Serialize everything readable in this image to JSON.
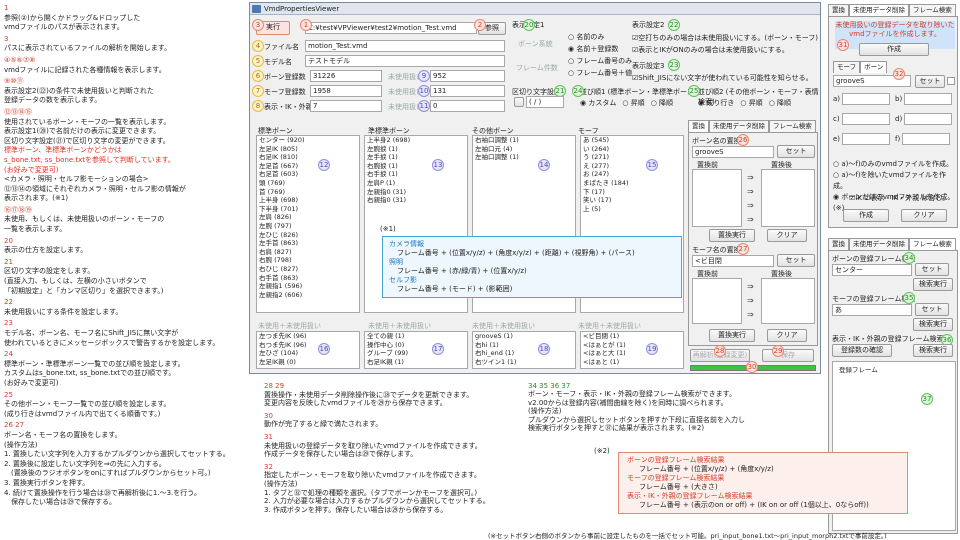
{
  "left_notes": [
    {
      "n": "1",
      "lines": [
        "参照(②)から開くかドラッグ&ドロップした",
        "vmdファイルのパスが表示されます。"
      ]
    },
    {
      "n": "3",
      "lines": [
        "パスに表示されているファイルの解析を開始します。"
      ]
    },
    {
      "n": "④⑤⑥⑦⑧",
      "lines": [
        "vmdファイルに記録された各種情報を表示します。"
      ]
    },
    {
      "n": "⑨⑩⑪",
      "lines": [
        "表示設定2(㉒)の条件で未使用扱いと判断された",
        "登録データの数を表示します。"
      ]
    },
    {
      "n": "⑫⑬⑭⑮",
      "lines": [
        "使用されているボーン・モーフの一覧を表示します。",
        "表示設定1(⑳)で名前だけの表示に変更できます。",
        "区切り文字設定(㉑)で区切り文字の変更ができます。"
      ],
      "red": [
        "標準ボーン、準標準ボーンかどうかは",
        "s_bone.txt, ss_bone.txtを参照して判断しています。",
        "(お好みで変更可)"
      ],
      "extra": [
        "<カメラ・照明・セルフ影モーションの場合>",
        "⑫⑬⑭の領域にそれぞれカメラ・照明・セルフ影の情報が",
        "表示されます。(※1)"
      ]
    },
    {
      "n": "⑯⑰⑱⑲",
      "lines": [
        "未使用、もしくは、未使用扱いのボーン・モーフの",
        "一覧を表示します。"
      ]
    },
    {
      "n": "20",
      "lines": [
        "表示の仕方を設定します。"
      ]
    },
    {
      "n": "21",
      "lines": [
        "区切り文字の設定をします。",
        "(直接入力、もしくは、左横の小さいボタンで",
        "「初期設定」と「カンマ区切り」を選択できます。)"
      ]
    },
    {
      "n": "22",
      "lines": [
        "未使用扱いにする条件を設定します。"
      ]
    },
    {
      "n": "23",
      "lines": [
        "モデル名、ボーン名、モーフ名にShift_JISに無い文字が",
        "使われているときにメッセージボックスで警告するかを設定します。"
      ]
    },
    {
      "n": "24",
      "lines": [
        "標準ボーン・準標準ボーン一覧での並び順を設定します。",
        "カスタムはs_bone.txt, ss_bone.txtでの並び順です。",
        "(お好みで変更可)"
      ]
    },
    {
      "n": "25",
      "lines": [
        "その他ボーン・モーフ一覧での並び順を設定します。",
        "(成り行きはvmdファイル内で出てくる順番です。)"
      ]
    },
    {
      "n": "26 27",
      "lines": [
        "ボーン名・モーフ名の置換をします。",
        "(操作方法)",
        "1. 置換したい文字列を入力するかプルダウンから選択してセットする。",
        "2. 置換後に設定したい文字列を⇒の先に入力する。",
        "　(置換後のラジオボタンをonにすればプルダウンからセット可。)",
        "3. 置換実行ボタンを押す。",
        "4. 続けて置換操作を行う場合は㉘で再解析後に1.～3.を行う。",
        "　保存したい場合は㉙で保存する。"
      ]
    }
  ],
  "window": {
    "title": "VmdPropertiesViewer",
    "run_button": "実行",
    "path": "C:¥test¥VPViewer¥test2¥motion_Test.vmd",
    "ref_button": "参照",
    "file_label": "ファイル名",
    "file_value": "motion_Test.vmd",
    "model_label": "モデル名",
    "model_value": "テストモデル",
    "bone_label": "ボーン登録数",
    "bone_value": "31226",
    "bone_unused_label": "未使用扱い",
    "bone_unused": "952",
    "morph_label": "モーフ登録数",
    "morph_value": "1958",
    "morph_unused_label": "未使用扱い",
    "morph_unused": "131",
    "disp_label": "表示・IK・外親",
    "disp_value": "7",
    "disp_unused_label": "未使用扱い",
    "disp_unused": "0",
    "setting1_label": "表示設定1",
    "setting1_bone_label": "ボーン系統",
    "setting1_morph_label": "フレーム件数",
    "radio1": [
      "名前のみ",
      "名前＋登録数",
      "フレーム番号のみ",
      "フレーム番号＋値"
    ],
    "sep_label": "区切り文字設定",
    "sep_value": "(    /    )",
    "setting2_label": "表示設定2",
    "setting2_opts": [
      "空打ちのみの場合は未使用扱いにする。(ボーン・モーフ)",
      "表示とIKがONのみの場合は未使用扱いにする。"
    ],
    "setting3_label": "表示設定3",
    "setting3_opt": "Shift_JISにない文字が使われている可能性を知らせる。",
    "sort1_label": "並び順1 (標準ボーン・準標準ボーン)",
    "sort1_opts": [
      "カスタム",
      "昇順",
      "降順"
    ],
    "sort2_label": "並び順2 (その他ボーン・モーフ・表情検索)",
    "sort2_opts": [
      "成り行き",
      "昇順",
      "降順"
    ],
    "col_headers": [
      "標準ボーン",
      "準標準ボーン",
      "その他ボーン",
      "モーフ"
    ],
    "std_bones": [
      "センター (920)",
      "左足IK (805)",
      "右足IK (810)",
      "左足首 (667)",
      "右足首 (603)",
      "頭 (769)",
      "首 (769)",
      "上半身 (698)",
      "下半身 (701)",
      "左肩 (826)",
      "左腕 (797)",
      "左ひじ (826)",
      "左手首 (863)",
      "右肩 (827)",
      "右腕 (798)",
      "右ひじ (827)",
      "右手首 (863)",
      "左親指1 (596)",
      "左親指2 (606)"
    ],
    "sub_bones": [
      "上半身2 (698)",
      "左腕捩 (1)",
      "左手捩 (1)",
      "右腕捩 (1)",
      "右手捩 (1)",
      "左肩P (1)",
      "左親指0 (31)",
      "右親指0 (31)"
    ],
    "other_bones": [
      "右袖口調整 (1)",
      "左袖口元 (4)",
      "左袖口調整 (1)"
    ],
    "morphs": [
      "あ (545)",
      "い (264)",
      "う (271)",
      "え (277)",
      "お (247)",
      "まばたき (184)",
      "下 (17)",
      "笑い (17)",
      "上 (5)"
    ],
    "note1": "(※1)",
    "unused_label": "未使用＋未使用扱い",
    "unused_std": [
      "左つま先IK (96)",
      "右つま先IK (96)",
      "左ひざ (104)",
      "左足IK親 (0)"
    ],
    "unused_sub": [
      "全ての親 (1)",
      "操作中心 (0)",
      "グルーブ (99)",
      "右足IK親 (1)"
    ],
    "unused_other": [
      "grooveS (1)",
      "右hi (1)",
      "右hi_end (1)",
      "右ツイン1 (1)"
    ],
    "unused_morph": [
      "<ビ目閉 (1)",
      "<はぁとが (1)",
      "<はぁと大 (1)",
      "<はぁと (1)"
    ],
    "reanalyze_button": "再解析(登録変更)",
    "save_button": "保存"
  },
  "replace_panel": {
    "tabs": [
      "置換",
      "未使用データ削除",
      "フレーム検索"
    ],
    "bone_label": "ボーン名の置換",
    "bone_value": "grooveS",
    "set_button": "セット",
    "before_label": "置換前",
    "after_label": "置換後",
    "exec_button": "置換実行",
    "clear_button": "クリア",
    "morph_label": "モーフ名の置換",
    "morph_value": "<ビ目閉",
    "set_button2": "セット",
    "before_label2": "置換前",
    "after_label2": "置換後",
    "exec_button2": "置換実行",
    "clear_button2": "クリア"
  },
  "camera_info": {
    "camera_title": "カメラ情報",
    "camera_line": "フレーム番号 + (位置x/y/z) + (角度x/y/z) + (距離) + (視野角) + (パース)",
    "light_title": "照明",
    "light_line": "フレーム番号 + (赤/緑/青) + (位置x/y/z)",
    "shadow_title": "セルフ影",
    "shadow_line": "フレーム番号 + (モード) + (影範囲)"
  },
  "delete_panel": {
    "tabs": [
      "置換",
      "未使用データ削除",
      "フレーム検索"
    ],
    "desc": [
      "未使用扱いの登録データを取り除いた",
      "vmdファイルを作成します。"
    ],
    "create_button": "作成",
    "subtabs": [
      "モーフ",
      "ボーン"
    ],
    "combo_value": "grooveS",
    "set_button": "セット",
    "radios": [
      "a)～f)のみのvmdファイルを作成。",
      "a)～f)を除いたvmdファイルを作成。",
      "ボーンだけのvmdファイルを作成。(※)"
    ],
    "checks": "☑IK ☑表示・IK・外親 は含む。",
    "create_button2": "作成",
    "clear_button": "クリア",
    "fields": [
      "a)",
      "b)",
      "c)",
      "d)",
      "e)",
      "f)"
    ]
  },
  "search_panel": {
    "tabs": [
      "置換",
      "未使用データ削除",
      "フレーム検索"
    ],
    "bone_label": "ボーンの登録フレーム検索",
    "bone_value": "センター",
    "set1": "セット",
    "search1": "検索実行",
    "morph_label": "モーフの登録フレーム検索",
    "morph_value": "あ",
    "set2": "セット",
    "search2": "検索実行",
    "disp_label": "表示・IK・外親の登録フレーム検索",
    "disp_button": "登録数の確認",
    "search3": "検索実行",
    "result_label": "登録フレーム"
  },
  "bottom_mid": [
    {
      "n": "28 29",
      "lines": [
        "置換操作・未使用データ削除操作後に㉘でデータを更新できます。",
        "変更内容を反映したvmdファイルを㉙から保存できます。"
      ]
    },
    {
      "n": "30",
      "lines": [
        "動作が完了すると緑で満たされます。"
      ]
    },
    {
      "n": "31",
      "lines": [
        "未使用扱いの登録データを取り除いたvmdファイルを作成できます。",
        "作成データを保存したい場合は㉙で保存します。"
      ]
    },
    {
      "n": "32",
      "lines": [
        "指定したボーン・モーフを取り除いたvmdファイルを作成できます。",
        "(操作方法)",
        "1. タブと㉜で処理の種類を選択。(タブでボーンかモーフを選択可。)",
        "2. 入力が必要な場合は入力するかプルダウンから選択してセットする。",
        "3. 作成ボタンを押す。保存したい場合は㉙から保存する。"
      ]
    }
  ],
  "bottom_right": {
    "n": "34 35 36 37",
    "lines": [
      "ボーン・モーフ・表示・IK・外親の登録フレーム検索ができます。",
      "v2.00からは登録内容(補間曲線を除く)を同時に調べられます。",
      "(操作方法)",
      "プルダウンから選択しセットボタンを押すか下段に直接名前を入力し",
      "検索実行ボタンを押すと㊲に結果が表示されます。(※2)"
    ],
    "note2": "(※2)"
  },
  "result_box": {
    "bone_title": "ボーンの登録フレーム検索結果",
    "bone_line": "フレーム番号 + (位置x/y/z) + (角度x/y/z)",
    "morph_title": "モーフの登録フレーム検索結果",
    "morph_line": "フレーム番号 + (大きさ)",
    "disp_title": "表示・IK・外親の登録フレーム検索結果",
    "disp_line": "フレーム番号 + (表示のon or off) + (IK on or off (1個以上、0ならoff))"
  },
  "footer": "(※セットボタン右側のボタンから事前に設定したものを一括でセット可能。pri_input_bone1.txt～pri_input_morph2.txtで事前設定。)"
}
